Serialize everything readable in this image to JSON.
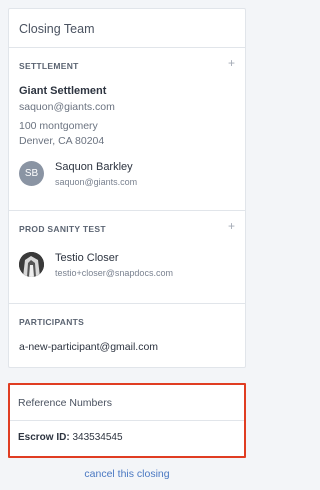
{
  "card": {
    "title": "Closing Team"
  },
  "settlement": {
    "section_title": "SETTLEMENT",
    "add_icon": "+",
    "company_name": "Giant Settlement",
    "company_email": "saquon@giants.com",
    "address_line1": "100 montgomery",
    "address_line2": "Denver, CA 80204",
    "contact": {
      "initials": "SB",
      "name": "Saquon Barkley",
      "email": "saquon@giants.com"
    }
  },
  "prod": {
    "section_title": "PROD SANITY TEST",
    "add_icon": "+",
    "contact": {
      "name": "Testio Closer",
      "email": "testio+closer@snapdocs.com"
    }
  },
  "participants": {
    "section_title": "PARTICIPANTS",
    "email": "a-new-participant@gmail.com"
  },
  "reference": {
    "title": "Reference Numbers",
    "escrow_label": "Escrow ID:",
    "escrow_value": "343534545"
  },
  "cancel_link": "cancel this closing",
  "colors": {
    "highlight_border": "#e03d22",
    "link": "#4a78c2"
  }
}
